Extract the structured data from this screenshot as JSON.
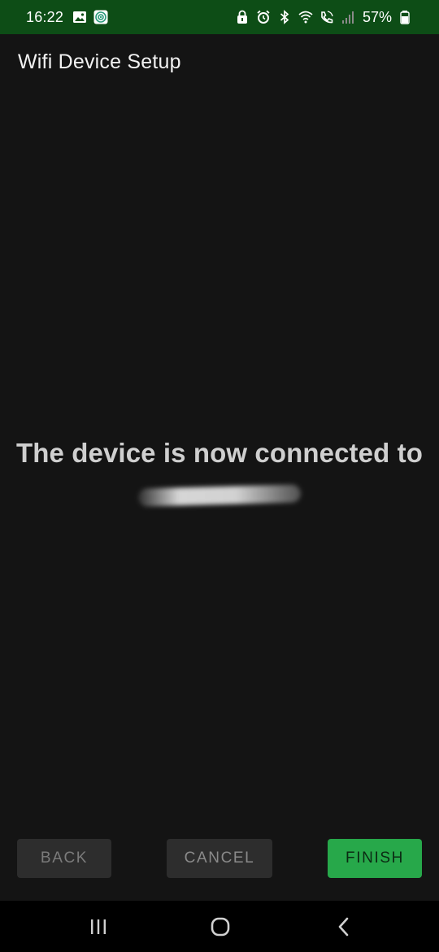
{
  "status_bar": {
    "time": "16:22",
    "battery_percent": "57%",
    "background_color": "#0d4d16",
    "left_icons": [
      "image-icon",
      "wifi-hotspot-icon"
    ],
    "right_icons": [
      "lock-icon",
      "alarm-icon",
      "bluetooth-icon",
      "wifi-icon",
      "wifi-call-icon",
      "signal-icon",
      "battery-icon"
    ]
  },
  "app": {
    "title": "Wifi Device Setup"
  },
  "main": {
    "message": "The device is now connected to"
  },
  "buttons": {
    "back_label": "BACK",
    "cancel_label": "CANCEL",
    "finish_label": "FINISH",
    "finish_color": "#27a84a"
  },
  "nav_bar": {
    "icons": [
      "recent-apps-icon",
      "home-icon",
      "back-icon"
    ]
  }
}
